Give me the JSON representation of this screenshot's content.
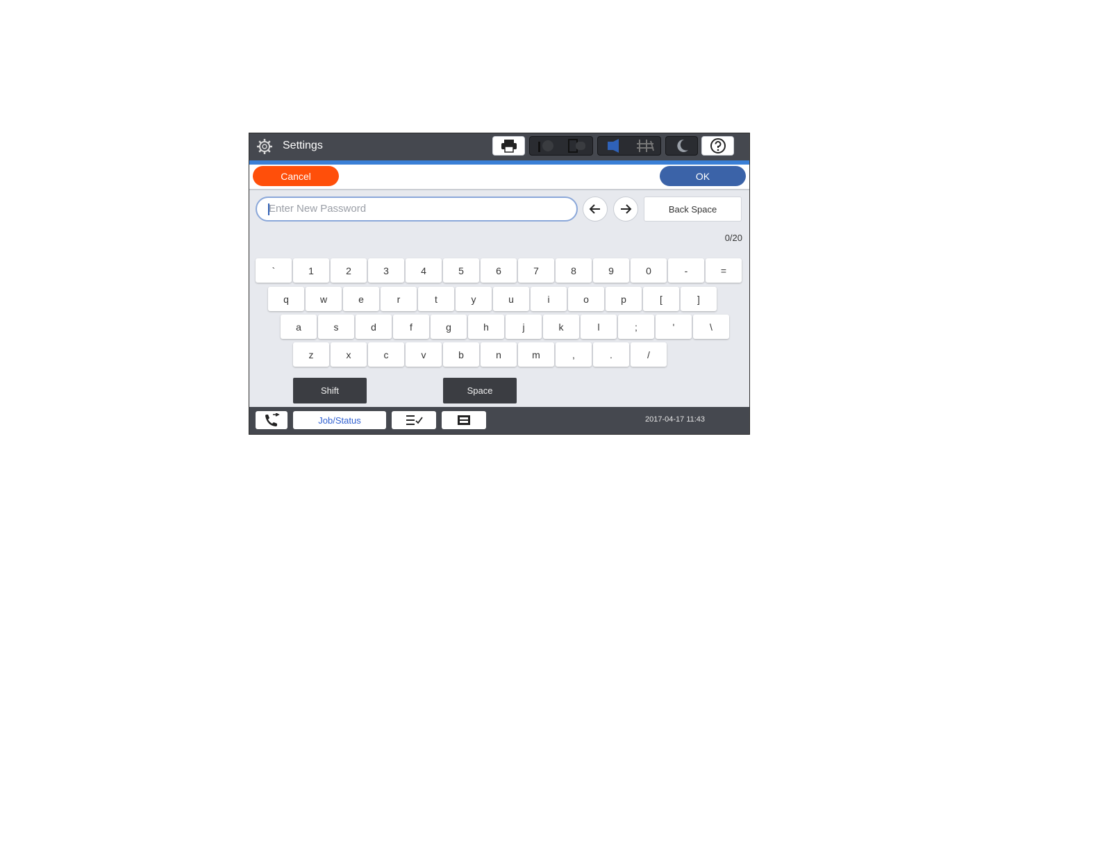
{
  "header": {
    "title": "Settings",
    "icons": [
      "gear-icon",
      "printer-icon",
      "ink-icon",
      "paper-icon",
      "volume-icon",
      "network-icon",
      "sleep-icon",
      "help-icon"
    ]
  },
  "actions": {
    "cancel_label": "Cancel",
    "ok_label": "OK"
  },
  "input": {
    "placeholder": "Enter New Password",
    "value": "",
    "counter": "0/20"
  },
  "nav": {
    "backspace_label": "Back Space",
    "left_icon": "arrow-left-icon",
    "right_icon": "arrow-right-icon"
  },
  "keyboard": {
    "rows": [
      [
        "`",
        "1",
        "2",
        "3",
        "4",
        "5",
        "6",
        "7",
        "8",
        "9",
        "0",
        "-",
        "="
      ],
      [
        "q",
        "w",
        "e",
        "r",
        "t",
        "y",
        "u",
        "i",
        "o",
        "p",
        "[",
        "]"
      ],
      [
        "a",
        "s",
        "d",
        "f",
        "g",
        "h",
        "j",
        "k",
        "l",
        ";",
        "'",
        "\\"
      ],
      [
        "z",
        "x",
        "c",
        "v",
        "b",
        "n",
        "m",
        ",",
        ".",
        "/"
      ]
    ],
    "shift_label": "Shift",
    "space_label": "Space"
  },
  "footer": {
    "job_status_label": "Job/Status",
    "datetime": "2017-04-17 11:43",
    "icons": [
      "fax-icon",
      "job-list-icon",
      "tray-icon"
    ]
  },
  "colors": {
    "cancel": "#ff4f0a",
    "ok": "#3b63a8",
    "header": "#45484f",
    "accent": "#3a7fd6"
  }
}
